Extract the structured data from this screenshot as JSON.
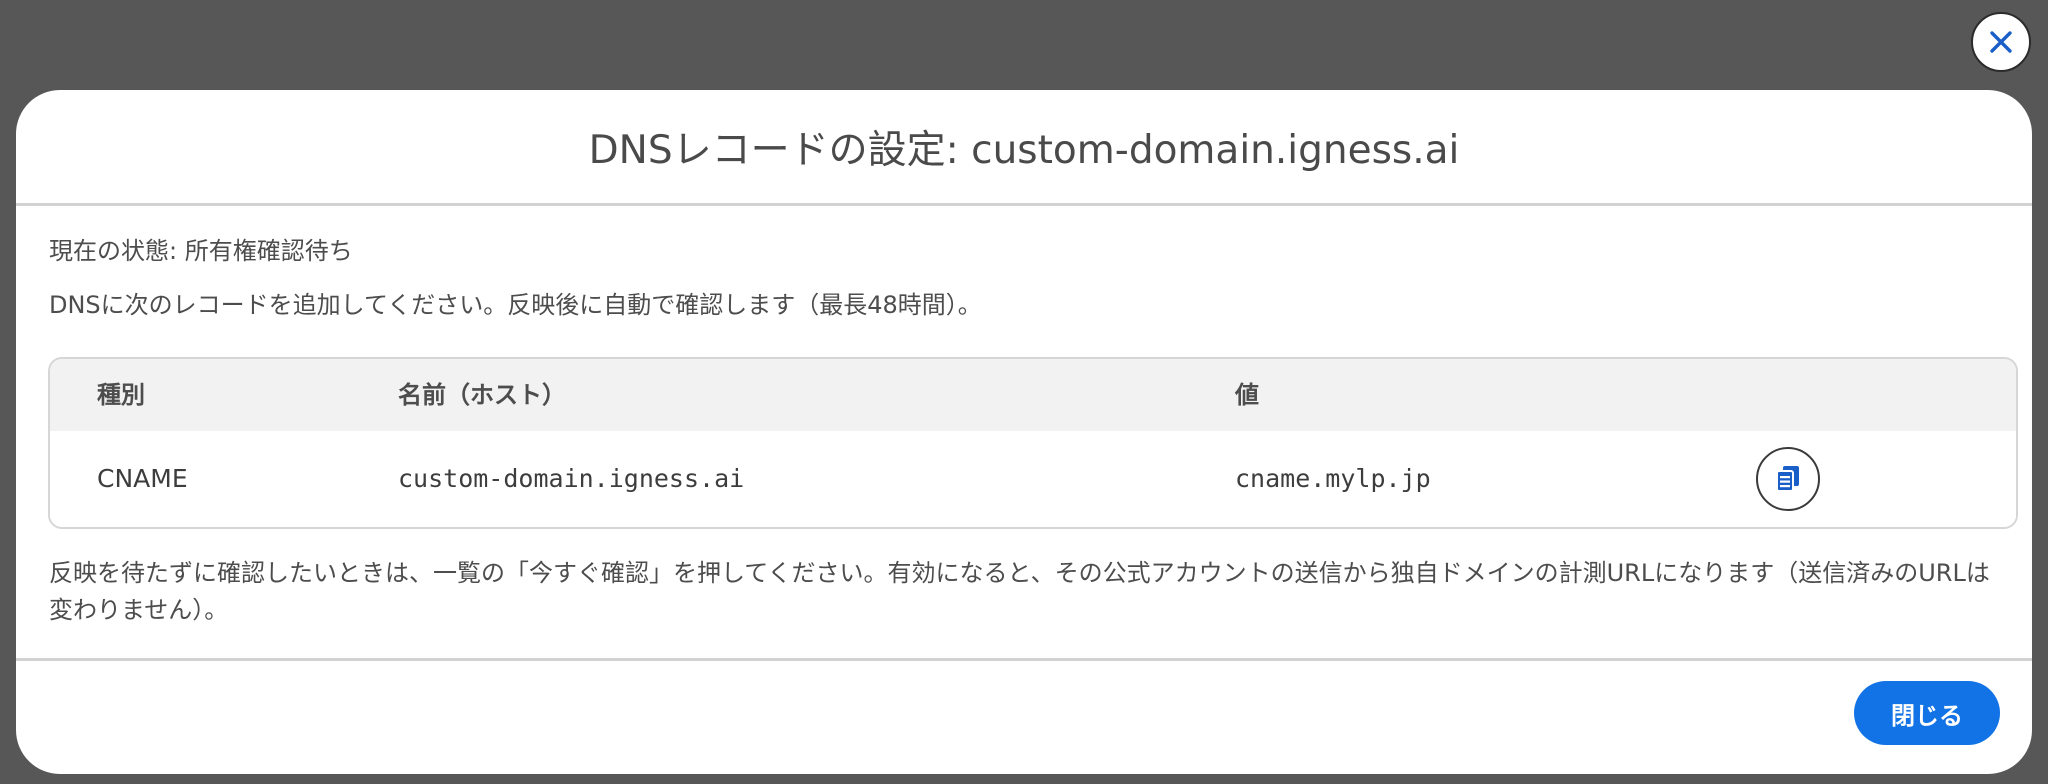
{
  "modal": {
    "title": "DNSレコードの設定: custom-domain.igness.ai",
    "close_icon": "close-icon",
    "status_text": "現在の状態: 所有権確認待ち",
    "instruction_text": "DNSに次のレコードを追加してください。反映後に自動で確認します（最長48時間）。",
    "table": {
      "headers": [
        "種別",
        "名前（ホスト）",
        "値"
      ],
      "rows": [
        {
          "type": "CNAME",
          "name": "custom-domain.igness.ai",
          "value": "cname.mylp.jp",
          "action_icon": "copy-icon"
        }
      ]
    },
    "note_text": "反映を待たずに確認したいときは、一覧の「今すぐ確認」を押してください。有効になると、その公式アカウントの送信から独自ドメインの計測URLになります（送信済みのURLは変わりません）。",
    "footer": {
      "close_label": "閉じる"
    }
  },
  "colors": {
    "backdrop": "#575757",
    "primary": "#1273e6",
    "close_icon": "#1a5fc8",
    "table_header_bg": "#f2f2f2"
  }
}
